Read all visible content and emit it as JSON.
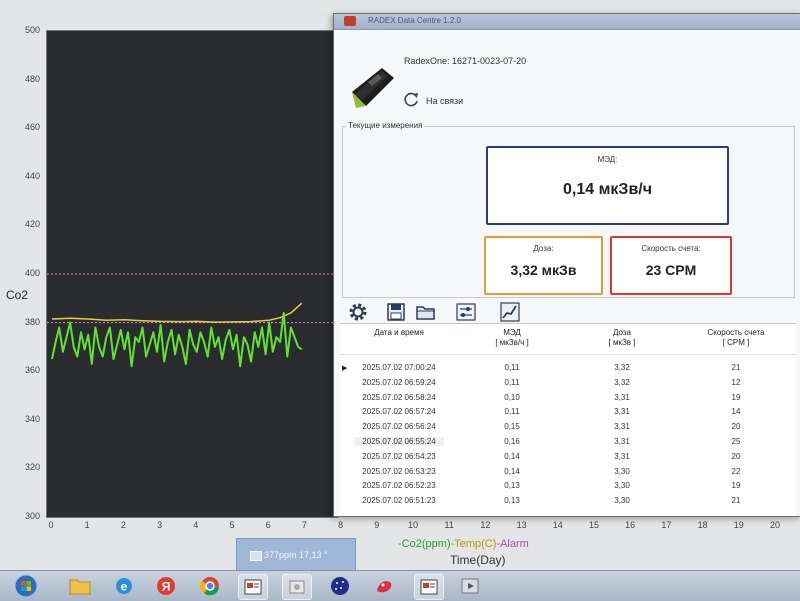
{
  "background_app": {
    "chart_data": {
      "type": "line",
      "ylabel": "Co2",
      "xlabel": "Time(Day)",
      "ylim": [
        300,
        500
      ],
      "xlim": [
        0,
        20
      ],
      "yticks": [
        "500",
        "480",
        "460",
        "440",
        "420",
        "400",
        "380",
        "360",
        "340",
        "320",
        "300"
      ],
      "xticks": [
        "0",
        "1",
        "2",
        "3",
        "4",
        "5",
        "6",
        "7",
        "8",
        "9",
        "10",
        "11",
        "12",
        "13",
        "14",
        "15",
        "16",
        "17",
        "18",
        "19",
        "20"
      ],
      "legend": {
        "co2": "-Co2(ppm)",
        "temp": "-Temp(C)",
        "alarm": "-Alarm"
      },
      "colors": {
        "co2": "#5fe32e",
        "temp": "#e8cf3a",
        "alarm": "#c060c0",
        "grid": "#e090e0"
      },
      "grid_lines_y": [
        400,
        380
      ],
      "series": [
        {
          "name": "-Temp(C)",
          "x": [
            0.0,
            0.5,
            1.0,
            1.5,
            2.0,
            2.5,
            3.0,
            3.5,
            4.0,
            4.5,
            5.0,
            5.5,
            6.0,
            6.3,
            6.6,
            6.9
          ],
          "values": [
            381.5,
            381.8,
            381.5,
            381.0,
            381.2,
            380.8,
            380.5,
            380.4,
            380.5,
            380.2,
            380.3,
            380.4,
            381.0,
            382.0,
            384.0,
            388.0
          ]
        },
        {
          "name": "-Co2(ppm)",
          "x": [
            0.0,
            0.1,
            0.2,
            0.3,
            0.4,
            0.5,
            0.6,
            0.7,
            0.8,
            0.9,
            1.0,
            1.1,
            1.2,
            1.3,
            1.4,
            1.5,
            1.6,
            1.7,
            1.8,
            1.9,
            2.0,
            2.1,
            2.2,
            2.3,
            2.4,
            2.5,
            2.6,
            2.7,
            2.8,
            2.9,
            3.0,
            3.1,
            3.2,
            3.3,
            3.4,
            3.5,
            3.6,
            3.7,
            3.8,
            3.9,
            4.0,
            4.1,
            4.2,
            4.3,
            4.4,
            4.5,
            4.6,
            4.7,
            4.8,
            4.9,
            5.0,
            5.1,
            5.2,
            5.3,
            5.4,
            5.5,
            5.6,
            5.7,
            5.8,
            5.9,
            6.0,
            6.1,
            6.2,
            6.3,
            6.4,
            6.5,
            6.6,
            6.7,
            6.8,
            6.9
          ],
          "values": [
            365,
            372,
            378,
            368,
            374,
            380,
            370,
            366,
            376,
            369,
            375,
            363,
            378,
            370,
            366,
            374,
            378,
            365,
            371,
            377,
            369,
            376,
            362,
            374,
            372,
            378,
            366,
            371,
            376,
            368,
            379,
            364,
            372,
            377,
            367,
            375,
            370,
            363,
            377,
            371,
            368,
            376,
            372,
            366,
            378,
            370,
            374,
            365,
            373,
            377,
            369,
            375,
            362,
            374,
            371,
            364,
            376,
            370,
            378,
            367,
            380,
            368,
            374,
            372,
            384,
            366,
            378,
            374,
            370,
            369
          ]
        }
      ]
    },
    "status_tile_text": "377ppm 17,13 °"
  },
  "radex_window": {
    "title": "RADEX Data Centre 1.2.0",
    "device_name": "RadexOne: 16271-0023-07-20",
    "connection_status": "На связи",
    "group_label": "Текущие измерения",
    "dose_rate": {
      "label": "МЭД:",
      "value": "0,14 мкЗв/ч"
    },
    "dose": {
      "label": "Доза:",
      "value": "3,32 мкЗв"
    },
    "count_rate": {
      "label": "Скорость счета:",
      "value": "23 CPM"
    },
    "colors": {
      "dose_rate_border": "#2b3c8c",
      "dose_border": "#e59a3c",
      "count_rate_border": "#d83a32"
    },
    "toolbar": [
      "settings-icon",
      "save-icon",
      "open-folder-icon",
      "sliders-icon",
      "chart-icon"
    ],
    "table": {
      "headers": [
        {
          "line1": "Дата и время",
          "line2": ""
        },
        {
          "line1": "МЭД",
          "line2": "[ мкЗв/ч ]"
        },
        {
          "line1": "Доза",
          "line2": "[ мкЗв ]"
        },
        {
          "line1": "Скорость счета",
          "line2": "[ CPM ]"
        }
      ],
      "rows": [
        {
          "datetime": "2025.07.02 07:00:24",
          "dose_rate": "0,11",
          "dose": "3,32",
          "cpm": "21"
        },
        {
          "datetime": "2025.07.02 06:59:24",
          "dose_rate": "0,11",
          "dose": "3,32",
          "cpm": "12"
        },
        {
          "datetime": "2025.07.02 06:58:24",
          "dose_rate": "0,10",
          "dose": "3,31",
          "cpm": "19"
        },
        {
          "datetime": "2025.07.02 06:57:24",
          "dose_rate": "0,11",
          "dose": "3,31",
          "cpm": "14"
        },
        {
          "datetime": "2025.07.02 06:56:24",
          "dose_rate": "0,15",
          "dose": "3,31",
          "cpm": "20"
        },
        {
          "datetime": "2025.07.02 06:55:24",
          "dose_rate": "0,16",
          "dose": "3,31",
          "cpm": "25"
        },
        {
          "datetime": "2025.07.02 06:54:23",
          "dose_rate": "0,14",
          "dose": "3,31",
          "cpm": "20"
        },
        {
          "datetime": "2025.07.02 06:53:23",
          "dose_rate": "0,14",
          "dose": "3,30",
          "cpm": "22"
        },
        {
          "datetime": "2025.07.02 06:52:23",
          "dose_rate": "0,13",
          "dose": "3,30",
          "cpm": "19"
        },
        {
          "datetime": "2025.07.02 06:51:23",
          "dose_rate": "0,13",
          "dose": "3,30",
          "cpm": "21"
        }
      ]
    }
  },
  "taskbar": {
    "items": [
      "start-button",
      "file-explorer-icon",
      "internet-explorer-icon",
      "yandex-browser-icon",
      "chrome-icon",
      "radex-app-icon",
      "co2-monitor-app-icon",
      "globe-app-icon",
      "paint-app-icon",
      "radex-app-icon-2",
      "media-app-icon"
    ]
  }
}
